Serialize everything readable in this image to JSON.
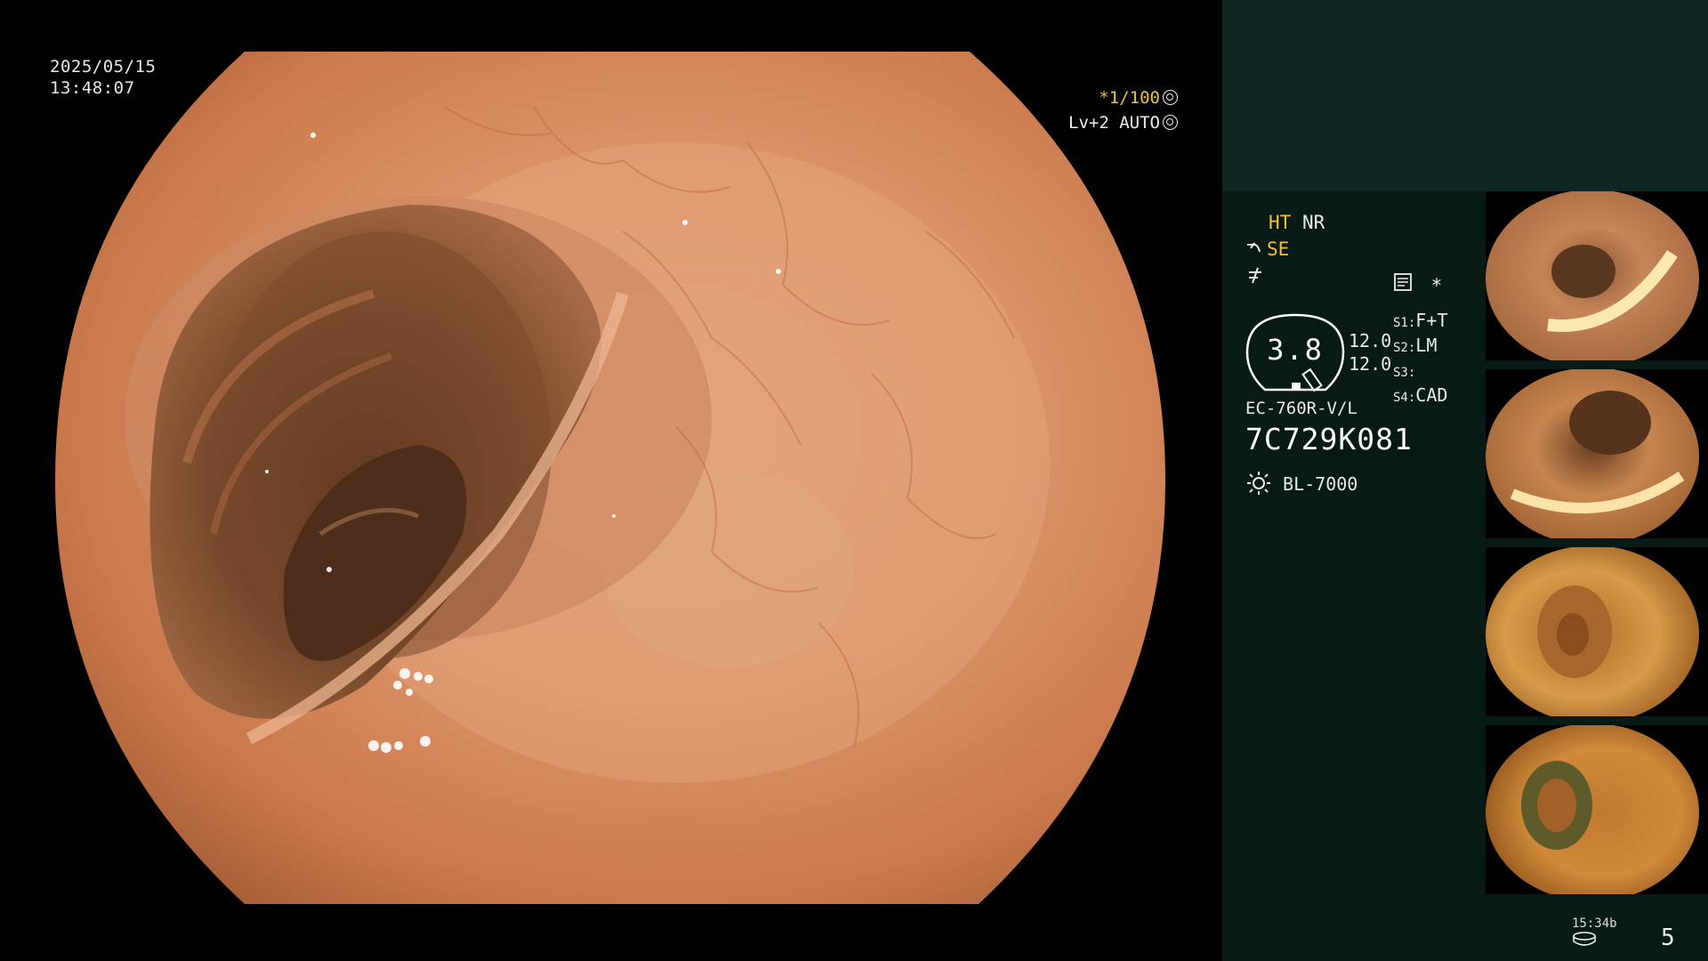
{
  "overlay": {
    "date": "2025/05/15",
    "time": "13:48:07",
    "shutter_prefix": "*",
    "shutter": "1/100",
    "level": "Lv+2",
    "auto": "AUTO"
  },
  "panel": {
    "ht": "HT",
    "nr": "NR",
    "se": "SE",
    "star": "*",
    "gauge_value": "3.8",
    "gain_1": "12.0",
    "gain_2": "12.0",
    "s1": "S1:",
    "s1_val": "F+T",
    "s2": "S2:",
    "s2_val": "LM",
    "s3": "S3:",
    "s3_val": "",
    "s4": "S4:",
    "s4_val": "CAD",
    "scope_model": "EC-760R-V/L",
    "serial": "7C729K081",
    "light_source": "BL-7000",
    "footer_time": "15:34b",
    "image_count": "5"
  },
  "colors": {
    "accent_yellow": "#f0c23a",
    "panel_bg": "#071a16",
    "panel_top": "#0e2622"
  },
  "icons": {
    "shutter_icon": "aperture-icon",
    "auto_icon": "aperture-icon",
    "se_icon": "curve-icon",
    "tilde_icon": "slash-icon",
    "menu_icon": "document-icon",
    "light_icon": "sun-icon",
    "storage_icon": "disk-icon"
  }
}
